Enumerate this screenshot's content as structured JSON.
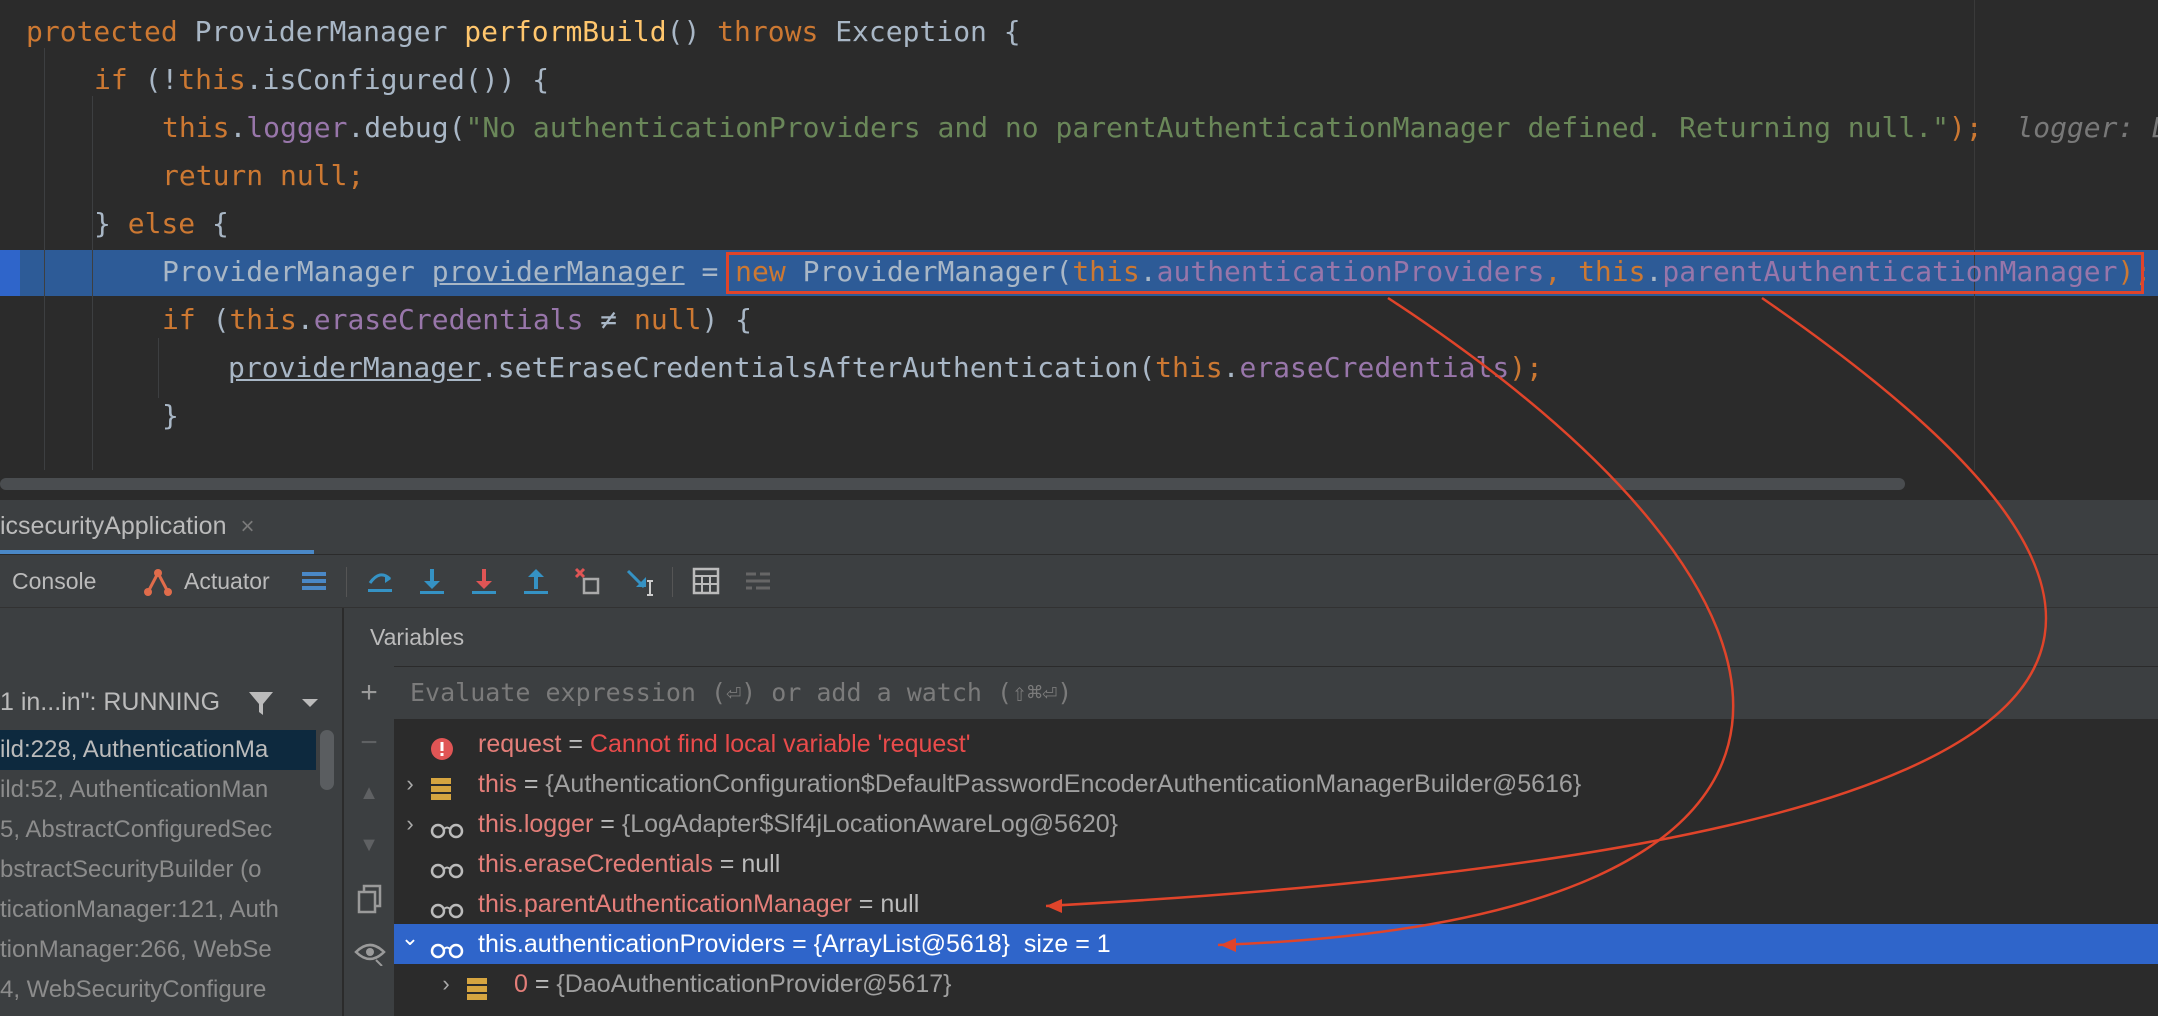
{
  "editor": {
    "lines": [
      {
        "segments": [
          {
            "t": "protected ",
            "c": "kw"
          },
          {
            "t": "ProviderManager "
          },
          {
            "t": "performBuild",
            "c": "fn"
          },
          {
            "t": "() "
          },
          {
            "t": "throws ",
            "c": "kw"
          },
          {
            "t": "Exception {"
          }
        ]
      },
      {
        "segments": [
          {
            "t": "if ",
            "c": "kw"
          },
          {
            "t": "(!"
          },
          {
            "t": "this",
            "c": "kw"
          },
          {
            "t": ".isConfigured()) {"
          }
        ]
      },
      {
        "segments": [
          {
            "t": "this",
            "c": "kw"
          },
          {
            "t": "."
          },
          {
            "t": "logger",
            "c": "fld"
          },
          {
            "t": ".debug("
          },
          {
            "t": "\"No authenticationProviders and no parentAuthenticationManager defined. Returning null.\"",
            "c": "str"
          },
          {
            "t": ");",
            "c": "kw"
          },
          {
            "t": "  logger: L",
            "c": "hint"
          }
        ]
      },
      {
        "segments": [
          {
            "t": "return null;",
            "c": "kw"
          }
        ]
      },
      {
        "segments": [
          {
            "t": "} "
          },
          {
            "t": "else ",
            "c": "kw"
          },
          {
            "t": "{"
          }
        ]
      },
      {
        "segments": [
          {
            "t": "ProviderManager "
          },
          {
            "t": "providerManager",
            "c": "var-ul"
          },
          {
            "t": " = "
          },
          {
            "t": "new ",
            "c": "kw"
          },
          {
            "t": "ProviderManager("
          },
          {
            "t": "this",
            "c": "kw"
          },
          {
            "t": "."
          },
          {
            "t": "authenticationProviders",
            "c": "fld"
          },
          {
            "t": ", ",
            "c": "kw"
          },
          {
            "t": "this",
            "c": "kw"
          },
          {
            "t": "."
          },
          {
            "t": "parentAuthenticationManager",
            "c": "fld"
          },
          {
            "t": ");",
            "c": "kw"
          }
        ]
      },
      {
        "segments": [
          {
            "t": "if ",
            "c": "kw"
          },
          {
            "t": "("
          },
          {
            "t": "this",
            "c": "kw"
          },
          {
            "t": "."
          },
          {
            "t": "eraseCredentials",
            "c": "fld"
          },
          {
            "t": " ≠ "
          },
          {
            "t": "null",
            "c": "kw"
          },
          {
            "t": ") {"
          }
        ]
      },
      {
        "segments": [
          {
            "t": "providerManager",
            "c": "var-ul"
          },
          {
            "t": ".setEraseCredentialsAfterAuthentication("
          },
          {
            "t": "this",
            "c": "kw"
          },
          {
            "t": "."
          },
          {
            "t": "eraseCredentials",
            "c": "fld"
          },
          {
            "t": ");",
            "c": "kw"
          }
        ]
      },
      {
        "segments": [
          {
            "t": "}"
          }
        ]
      }
    ]
  },
  "run_tab": {
    "label": "icsecurityApplication",
    "close": "×"
  },
  "toolbar": {
    "console_label": "Console",
    "actuator_label": "Actuator"
  },
  "frames": {
    "thread": "1 in...in\": RUNNING",
    "items": [
      "ild:228, AuthenticationMa",
      "ild:52, AuthenticationMan",
      "5, AbstractConfiguredSec",
      "bstractSecurityBuilder (o",
      "ticationManager:121, Auth",
      "tionManager:266, WebSe",
      "4, WebSecurityConfigure"
    ]
  },
  "variables": {
    "title": "Variables",
    "eval_placeholder": "Evaluate expression (⏎) or add a watch (⇧⌘⏎)",
    "rows": [
      {
        "name": "request",
        "eq": " = ",
        "value": "Cannot find local variable 'request'",
        "kind": "error"
      },
      {
        "name": "this",
        "eq": " = ",
        "value": "{AuthenticationConfiguration$DefaultPasswordEncoderAuthenticationManagerBuilder@5616}",
        "kind": "object"
      },
      {
        "name": "this.logger",
        "eq": " = ",
        "value": "{LogAdapter$Slf4jLocationAwareLog@5620}",
        "kind": "watch"
      },
      {
        "name": "this.eraseCredentials",
        "eq": " = ",
        "value": "null",
        "kind": "watch"
      },
      {
        "name": "this.parentAuthenticationManager",
        "eq": " = ",
        "value": "null",
        "kind": "watch"
      },
      {
        "name": "this.authenticationProviders",
        "eq": " = ",
        "value": "{ArrayList@5618}  size = 1",
        "kind": "watch-selected"
      },
      {
        "name": "0",
        "eq": " = ",
        "value": "{DaoAuthenticationProvider@5617}",
        "kind": "child"
      }
    ]
  },
  "colors": {
    "annotation_red": "#e0442a",
    "selection_blue": "#2f65ca",
    "exec_line": "#2d5b97"
  }
}
